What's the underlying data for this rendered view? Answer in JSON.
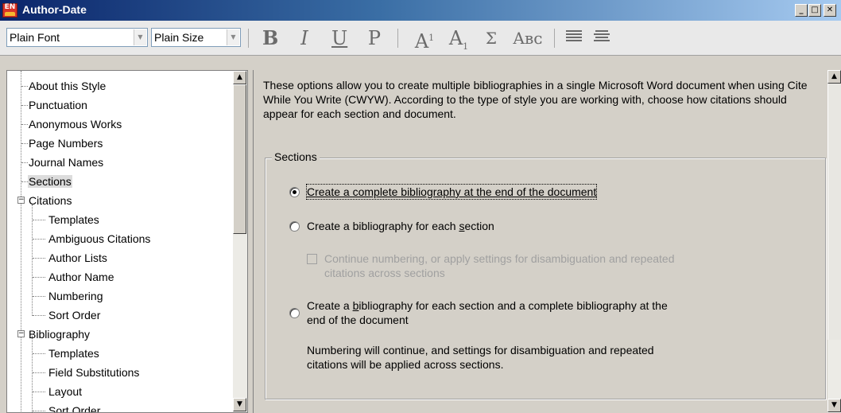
{
  "window": {
    "title": "Author-Date",
    "app_icon_text": "EN",
    "controls": {
      "minimize": "_",
      "maximize": "□",
      "close": "✕"
    }
  },
  "toolbar": {
    "font_value": "Plain Font",
    "size_value": "Plain Size",
    "bold": "B",
    "italic": "I",
    "underline": "U",
    "plain": "P",
    "superscript_base": "A",
    "superscript_mark": "1",
    "subscript_base": "A",
    "subscript_mark": "1",
    "symbol": "Σ",
    "small_caps": "Aʙᴄ",
    "icon_color": "#6b6b6b"
  },
  "tree": {
    "items": [
      {
        "label": "About this Style"
      },
      {
        "label": "Punctuation"
      },
      {
        "label": "Anonymous Works"
      },
      {
        "label": "Page Numbers"
      },
      {
        "label": "Journal Names"
      },
      {
        "label": "Sections",
        "selected": true
      },
      {
        "label": "Citations",
        "expanded": true
      },
      {
        "label": "Templates"
      },
      {
        "label": "Ambiguous Citations"
      },
      {
        "label": "Author Lists"
      },
      {
        "label": "Author Name"
      },
      {
        "label": "Numbering"
      },
      {
        "label": "Sort Order"
      },
      {
        "label": "Bibliography",
        "expanded": true
      },
      {
        "label": "Templates"
      },
      {
        "label": "Field Substitutions"
      },
      {
        "label": "Layout"
      },
      {
        "label": "Sort Order"
      }
    ],
    "expander_symbol": "−"
  },
  "content": {
    "intro": "These options allow you to create multiple bibliographies in a single Microsoft Word document when using Cite While You Write (CWYW). According to the type of style you are working with, choose how citations should appear for each section and document.",
    "group_label": "Sections",
    "option1": {
      "text": "Create a complete bibliography at the end of the document",
      "checked": true
    },
    "option2": {
      "pre": "Create a bibliography for each ",
      "accel": "s",
      "post": "ection",
      "checked": false
    },
    "checkbox": {
      "line1": "Continue numbering, or apply settings for disambiguation and repeated",
      "line2": "citations across sections",
      "checked": false,
      "enabled": false
    },
    "option3": {
      "pre": "Create a ",
      "accel": "b",
      "post": "ibliography for each section and a complete bibliography at the",
      "line2": "end of the document",
      "checked": false
    },
    "note_line1": "Numbering will continue, and settings for disambiguation and repeated",
    "note_line2": "citations will be applied across sections."
  },
  "colors": {
    "titlebar_start": "#0a246a",
    "titlebar_end": "#a6caf0",
    "dialog_bg": "#d4d0c8",
    "selection_bg": "#dcdcdc"
  }
}
